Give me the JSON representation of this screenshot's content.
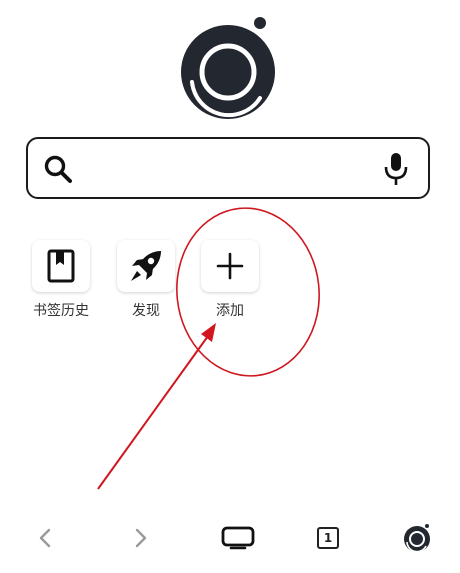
{
  "search": {
    "placeholder": ""
  },
  "shortcuts": [
    {
      "label": "书签历史",
      "icon": "bookmark-icon"
    },
    {
      "label": "发现",
      "icon": "rocket-icon"
    },
    {
      "label": "添加",
      "icon": "plus-icon"
    }
  ],
  "bottom_nav": {
    "back_icon": "chevron-left-icon",
    "forward_icon": "chevron-right-icon",
    "tabs_view_icon": "tablet-icon",
    "tab_count": "1",
    "menu_icon": "app-logo-icon"
  },
  "annotation": {
    "color": "#d0161f"
  }
}
